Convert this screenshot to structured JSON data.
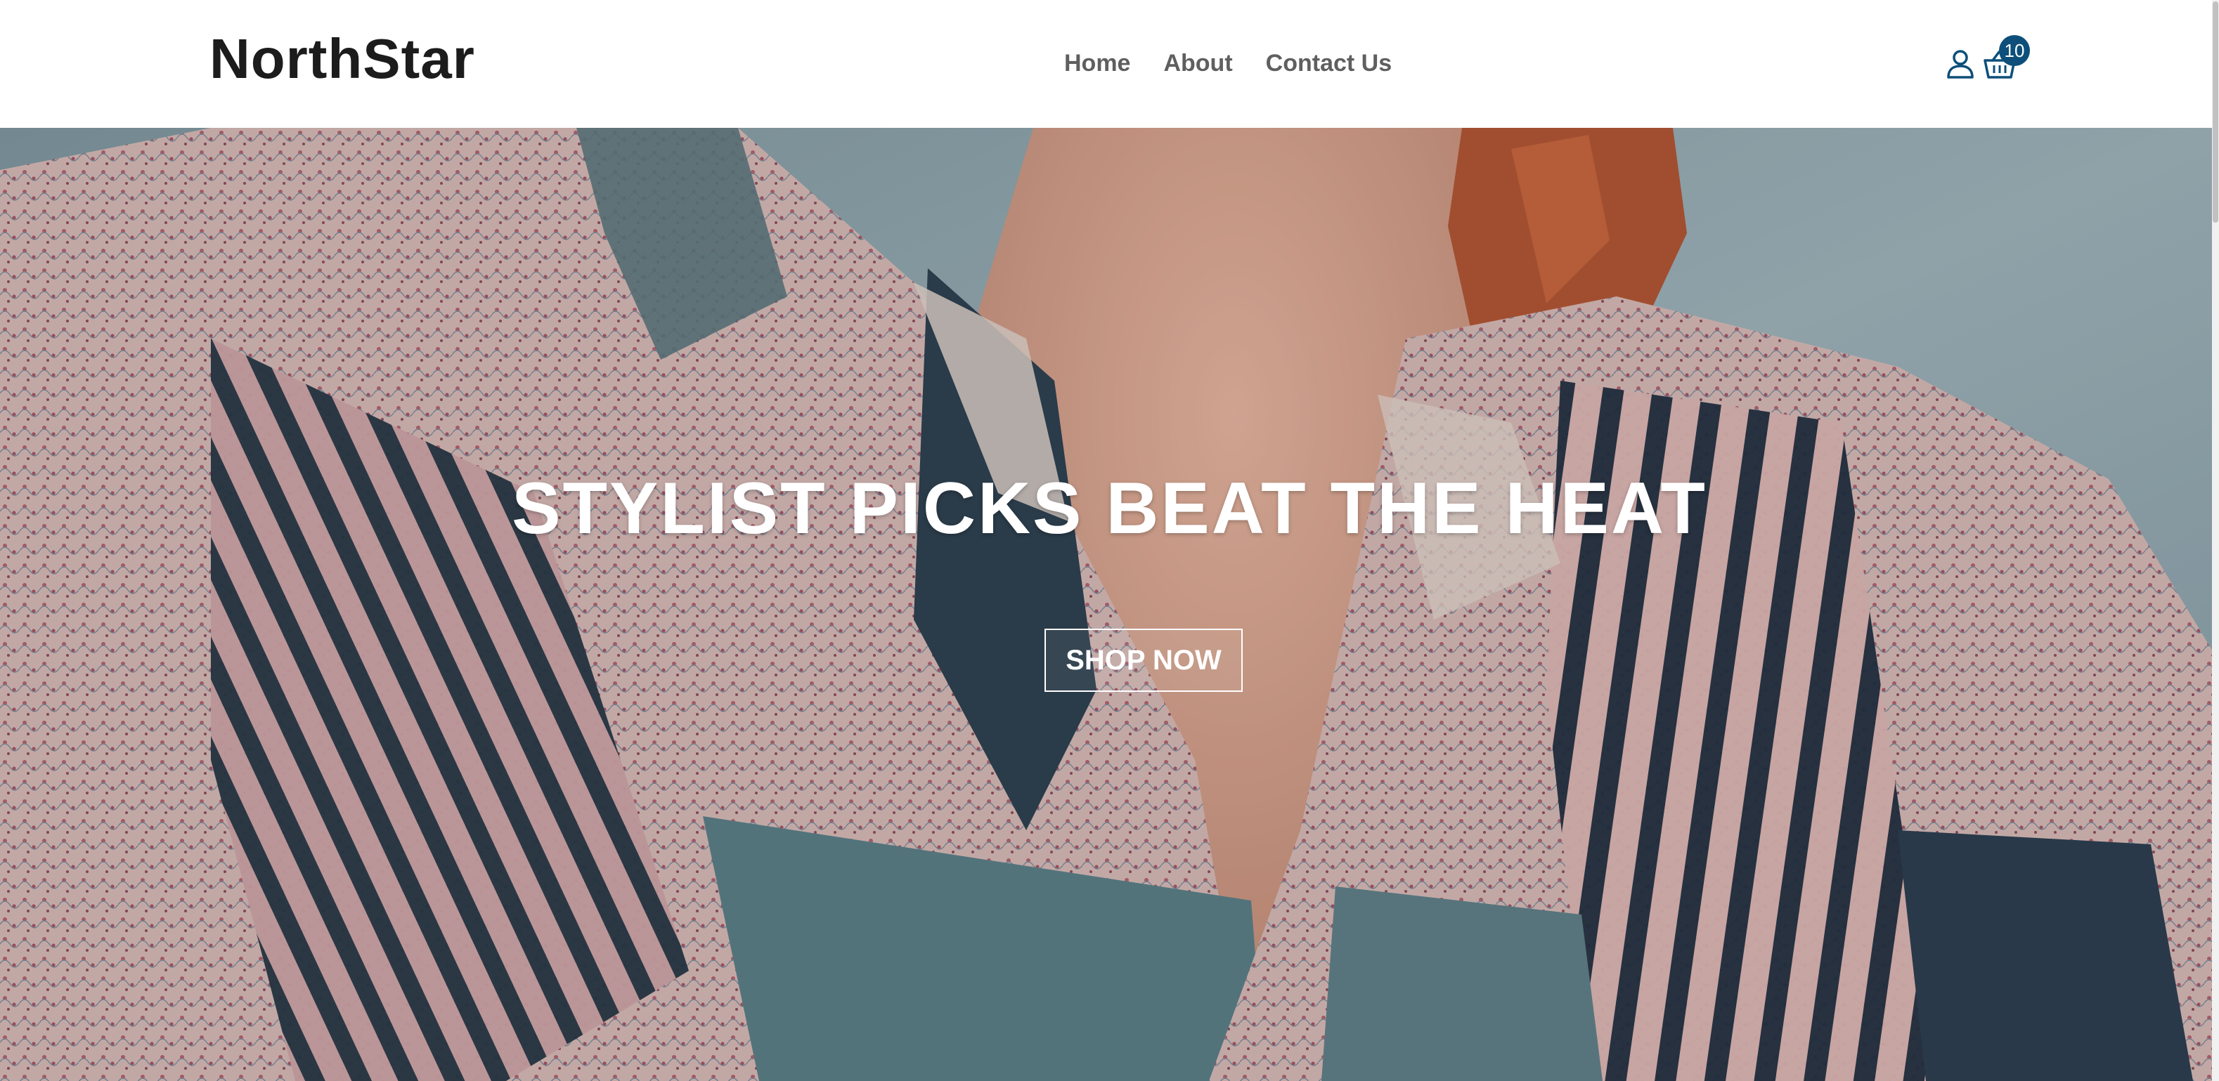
{
  "header": {
    "logo": "NorthStar",
    "nav": [
      {
        "label": "Home"
      },
      {
        "label": "About"
      },
      {
        "label": "Contact Us"
      }
    ],
    "icons": {
      "account": "user-icon",
      "cart": "basket-icon"
    },
    "cart_count": "10"
  },
  "hero": {
    "title": "STYLIST PICKS BEAT THE HEAT",
    "cta_label": "SHOP NOW"
  },
  "colors": {
    "badge": "#0d4f7a",
    "logo": "#1c1c1c",
    "nav_text": "#5f5f5f",
    "hero_text": "#ffffff"
  }
}
